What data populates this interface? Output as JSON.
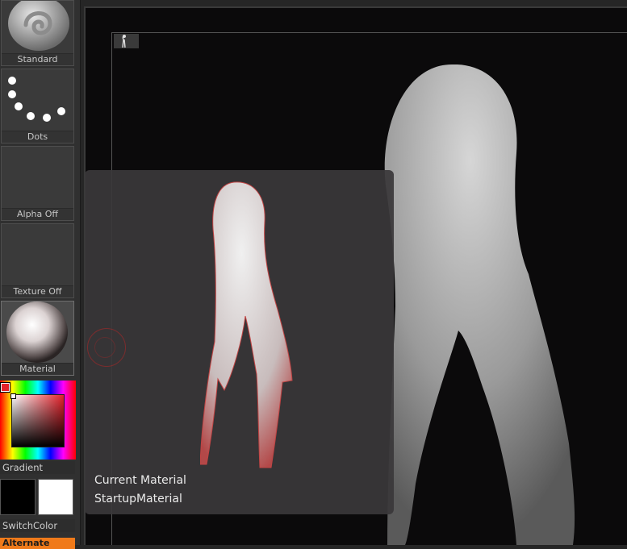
{
  "left_panel": {
    "brush_label": "Standard",
    "stroke_label": "Dots",
    "alpha_label": "Alpha Off",
    "texture_label": "Texture Off",
    "material_label": "Material",
    "gradient_label": "Gradient",
    "switch_label": "SwitchColor",
    "alternate_label": "Alternate"
  },
  "colors": {
    "main_color": "#e4212a",
    "primary_swatch": "#000000",
    "secondary_swatch": "#ffffff",
    "alternate_accent": "#f07a1a"
  },
  "tooltip": {
    "title": "Current Material",
    "material_name": "StartupMaterial"
  }
}
